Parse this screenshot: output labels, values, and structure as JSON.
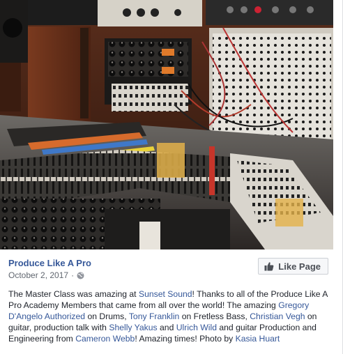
{
  "post": {
    "image_alt": "Recording studio mixing console with patch bays",
    "page_name": "Produce Like A Pro",
    "date": "October 2, 2017",
    "separator": "·",
    "privacy_icon": "globe-icon",
    "like_button": {
      "label": "Like Page",
      "icon": "thumbs-up-icon"
    },
    "text": [
      {
        "t": "The Master Class was amazing at ",
        "link": false
      },
      {
        "t": "Sunset Sound",
        "link": true
      },
      {
        "t": "! Thanks to all of the Produce Like A Pro Academy Members that came from all over the world! The amazing ",
        "link": false
      },
      {
        "t": "Gregory D'Angelo Authorized",
        "link": true
      },
      {
        "t": " on Drums, ",
        "link": false
      },
      {
        "t": "Tony Franklin",
        "link": true
      },
      {
        "t": " on Fretless Bass, ",
        "link": false
      },
      {
        "t": "Christian Vegh",
        "link": true
      },
      {
        "t": " on guitar, production talk with ",
        "link": false
      },
      {
        "t": "Shelly Yakus",
        "link": true
      },
      {
        "t": " and ",
        "link": false
      },
      {
        "t": "Ulrich Wild",
        "link": true
      },
      {
        "t": " and guitar Production and Engineering from ",
        "link": false
      },
      {
        "t": "Cameron Webb",
        "link": true
      },
      {
        "t": "! Amazing times! Photo by ",
        "link": false
      },
      {
        "t": "Kasia Huart",
        "link": true
      }
    ]
  },
  "colors": {
    "link": "#365899",
    "text": "#1d2129",
    "meta": "#616770",
    "button_bg": "#f6f7f9",
    "button_border": "#ccd0d5"
  }
}
